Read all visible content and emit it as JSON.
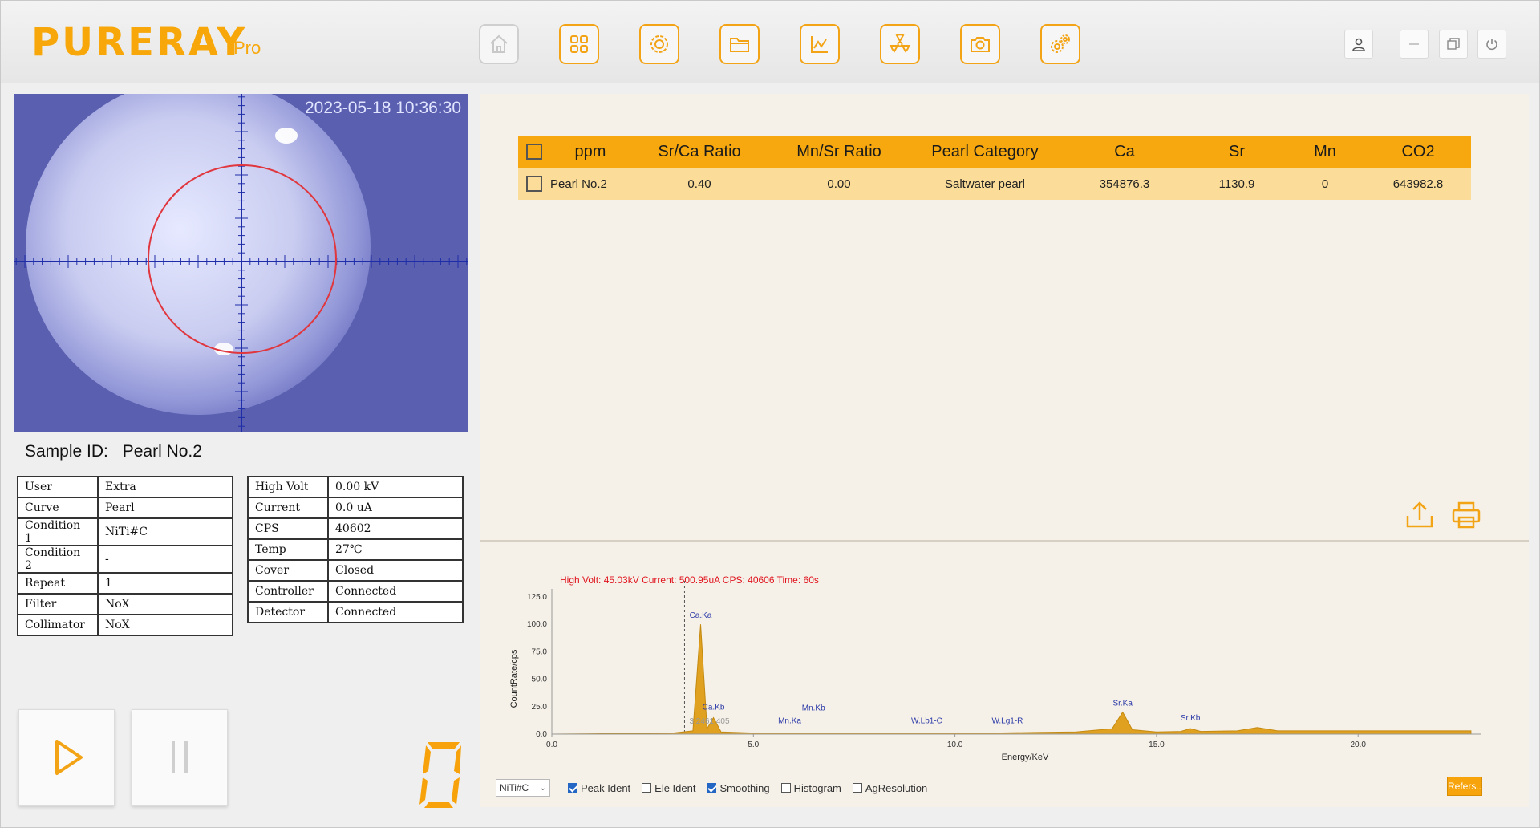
{
  "app": {
    "logo": "PURERAY",
    "edition": "Pro"
  },
  "toolbar": {
    "icons": [
      "home-icon",
      "apps-icon",
      "settings-icon",
      "folder-icon",
      "chart-icon",
      "radiation-icon",
      "camera-icon",
      "gears-icon"
    ]
  },
  "window": {
    "icons": [
      "user-icon",
      "minimize-icon",
      "restore-icon",
      "power-icon"
    ]
  },
  "camera": {
    "timestamp": "2023-05-18 10:36:30"
  },
  "sample": {
    "label": "Sample ID:",
    "value": "Pearl No.2"
  },
  "info_left": [
    {
      "key": "User",
      "value": "Extra"
    },
    {
      "key": "Curve",
      "value": "Pearl"
    },
    {
      "key": "Condition 1",
      "value": "NiTi#C"
    },
    {
      "key": "Condition 2",
      "value": "-"
    },
    {
      "key": "Repeat",
      "value": "1"
    },
    {
      "key": "Filter",
      "value": "NoX"
    },
    {
      "key": "Collimator",
      "value": "NoX"
    }
  ],
  "info_right": [
    {
      "key": "High Volt",
      "value": "0.00 kV"
    },
    {
      "key": "Current",
      "value": "0.0 uA"
    },
    {
      "key": "CPS",
      "value": "40602"
    },
    {
      "key": "Temp",
      "value": "27℃"
    },
    {
      "key": "Cover",
      "value": "Closed"
    },
    {
      "key": "Controller",
      "value": "Connected"
    },
    {
      "key": "Detector",
      "value": "Connected"
    }
  ],
  "controls": {
    "play_icon": "play-icon",
    "pause_icon": "pause-icon",
    "counter": "0"
  },
  "results": {
    "headers": [
      "ppm",
      "Sr/Ca Ratio",
      "Mn/Sr Ratio",
      "Pearl Category",
      "Ca",
      "Sr",
      "Mn",
      "CO2"
    ],
    "rows": [
      [
        "Pearl No.2",
        "0.40",
        "0.00",
        "Saltwater pearl",
        "354876.3",
        "1130.9",
        "0",
        "643982.8"
      ]
    ],
    "export_icon": "export-icon",
    "print_icon": "print-icon"
  },
  "spectrum": {
    "status": "High Volt: 45.03kV  Current: 500.95uA  CPS: 40606  Time: 60s",
    "ylabel": "CountRate/cps",
    "xlabel": "Energy/KeV",
    "yticks": [
      "125.0",
      "100.0",
      "75.0",
      "50.0",
      "25.0",
      "0.0"
    ],
    "xticks": [
      "0.0",
      "5.0",
      "10.0",
      "15.0",
      "20.0"
    ],
    "cursor_label": "3.2461.405",
    "peaks": [
      {
        "label": "Ca.Ka",
        "energy": 3.69
      },
      {
        "label": "Ca.Kb",
        "energy": 4.01
      },
      {
        "label": "Mn.Ka",
        "energy": 5.9
      },
      {
        "label": "Mn.Kb",
        "energy": 6.49
      },
      {
        "label": "W.Lb1-C",
        "energy": 9.3
      },
      {
        "label": "W.Lg1-R",
        "energy": 11.3
      },
      {
        "label": "Sr.Ka",
        "energy": 14.16
      },
      {
        "label": "Sr.Kb",
        "energy": 15.84
      }
    ],
    "curve_select": "NiTi#C",
    "options": [
      {
        "label": "Peak Ident",
        "checked": true
      },
      {
        "label": "Ele Ident",
        "checked": false
      },
      {
        "label": "Smoothing",
        "checked": true
      },
      {
        "label": "Histogram",
        "checked": false
      },
      {
        "label": "AgResolution",
        "checked": false
      }
    ],
    "refers_button": "Refers..",
    "line_color": "#e0a020",
    "status_color": "#e0141e"
  },
  "chart_data": {
    "type": "area",
    "x": [
      0.0,
      1.0,
      2.0,
      3.0,
      3.5,
      3.69,
      3.85,
      4.01,
      4.2,
      5.0,
      6.0,
      7.0,
      8.0,
      9.0,
      10.0,
      11.0,
      12.0,
      13.0,
      13.9,
      14.16,
      14.4,
      15.0,
      15.6,
      15.84,
      16.1,
      17.0,
      17.5,
      18.0,
      19.0,
      20.0,
      21.0,
      22.0,
      22.8
    ],
    "y": [
      0.0,
      0.3,
      0.6,
      1.0,
      3.0,
      100.0,
      5.0,
      15.0,
      2.0,
      1.0,
      1.0,
      1.0,
      1.0,
      1.0,
      1.0,
      1.0,
      1.5,
      2.0,
      5.0,
      20.0,
      4.0,
      2.0,
      2.5,
      5.0,
      2.5,
      3.0,
      6.0,
      3.0,
      3.0,
      3.0,
      3.0,
      3.0,
      3.0
    ],
    "xlabel": "Energy/KeV",
    "ylabel": "CountRate/cps",
    "xlim": [
      0.0,
      23.0
    ],
    "ylim": [
      0.0,
      125.0
    ]
  }
}
